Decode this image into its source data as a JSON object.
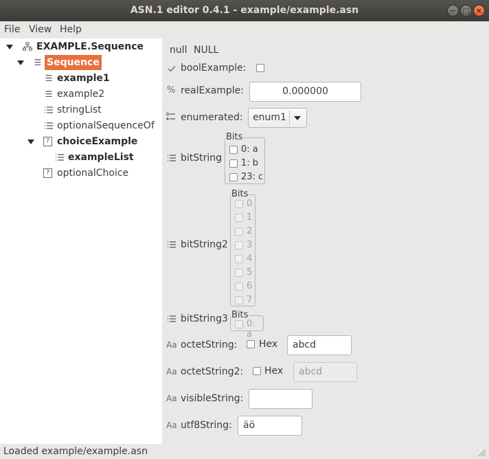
{
  "window": {
    "title": "ASN.1 editor 0.4.1 - example/example.asn",
    "btn_min": "−",
    "btn_max": "□",
    "btn_close": "×"
  },
  "menu": {
    "file": "File",
    "view": "View",
    "help": "Help"
  },
  "tree": {
    "root": "EXAMPLE.Sequence",
    "sequence": "Sequence",
    "example1": "example1",
    "example2": "example2",
    "stringList": "stringList",
    "optionalSequenceOf": "optionalSequenceOf",
    "choiceExample": "choiceExample",
    "exampleList": "exampleList",
    "optionalChoice": "optionalChoice",
    "q_mark": "?"
  },
  "form": {
    "null_label": "null",
    "null_value": "NULL",
    "bool_label": "boolExample:",
    "real_label": "realExample:",
    "real_value": "0.000000",
    "real_icon": "%",
    "enum_label": "enumerated:",
    "enum_value": "enum1",
    "bitstring_label": "bitString",
    "bitstring2_label": "bitString2",
    "bitstring3_label": "bitString3",
    "bits_title": "Bits",
    "bitstring_bits": [
      "0: a",
      "1: b",
      "23: c"
    ],
    "bitstring2_bits": [
      "0",
      "1",
      "2",
      "3",
      "4",
      "5",
      "6",
      "7"
    ],
    "bitstring3_bits": [
      "0: a"
    ],
    "aa_icon": "Aa",
    "octet_label": "octetString:",
    "octet_hex": "Hex",
    "octet_value": "abcd",
    "octet2_label": "octetString2:",
    "octet2_hex": "Hex",
    "octet2_value": "abcd",
    "visible_label": "visibleString:",
    "visible_value": "",
    "utf8_label": "utf8String:",
    "utf8_value": "äö"
  },
  "status": {
    "text": "Loaded example/example.asn"
  },
  "colors": {
    "selection": "#e9703c",
    "titlebar": "#3c3b37"
  }
}
